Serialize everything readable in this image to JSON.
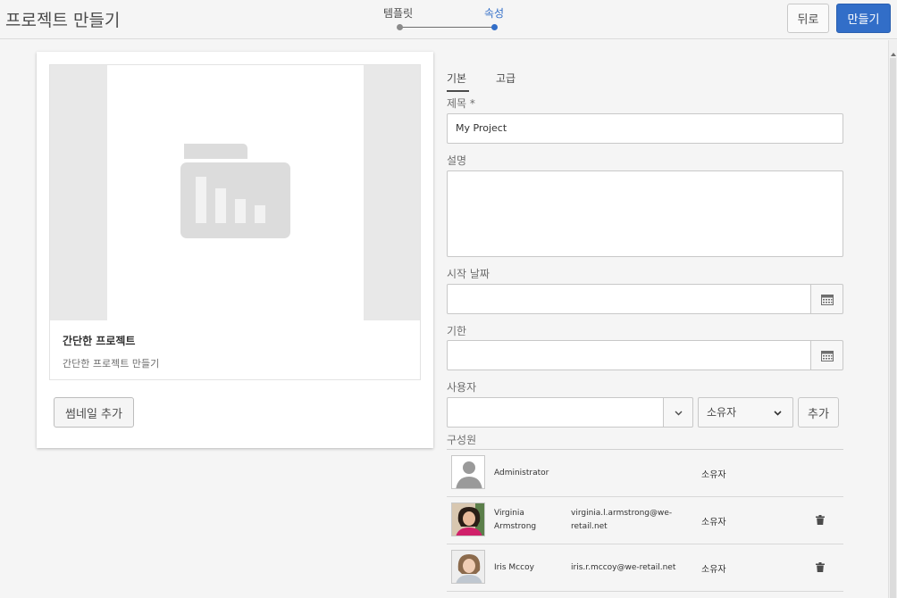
{
  "header": {
    "title": "프로젝트 만들기",
    "steps": [
      "템플릿",
      "속성"
    ],
    "back_label": "뒤로",
    "create_label": "만들기"
  },
  "template_card": {
    "title": "간단한 프로젝트",
    "description": "간단한 프로젝트 만들기",
    "add_thumbnail_label": "썸네일 추가"
  },
  "form": {
    "tabs": [
      "기본",
      "고급"
    ],
    "title_label": "제목 *",
    "title_value": "My Project",
    "description_label": "설명",
    "start_date_label": "시작 날짜",
    "due_date_label": "기한",
    "user_label": "사용자",
    "role_value": "소유자",
    "add_label": "추가",
    "members_label": "구성원"
  },
  "members": [
    {
      "name": "Administrator",
      "email": "",
      "role": "소유자",
      "avatar": "placeholder-person-icon"
    },
    {
      "name": "Virginia Armstrong",
      "email": "virginia.l.armstrong@we-retail.net",
      "role": "소유자",
      "avatar": "photo-woman-dark-hair"
    },
    {
      "name": "Iris Mccoy",
      "email": "iris.r.mccoy@we-retail.net",
      "role": "소유자",
      "avatar": "photo-woman-light-hair"
    }
  ],
  "colors": {
    "accent": "#326ec8",
    "background": "#f5f5f5"
  }
}
